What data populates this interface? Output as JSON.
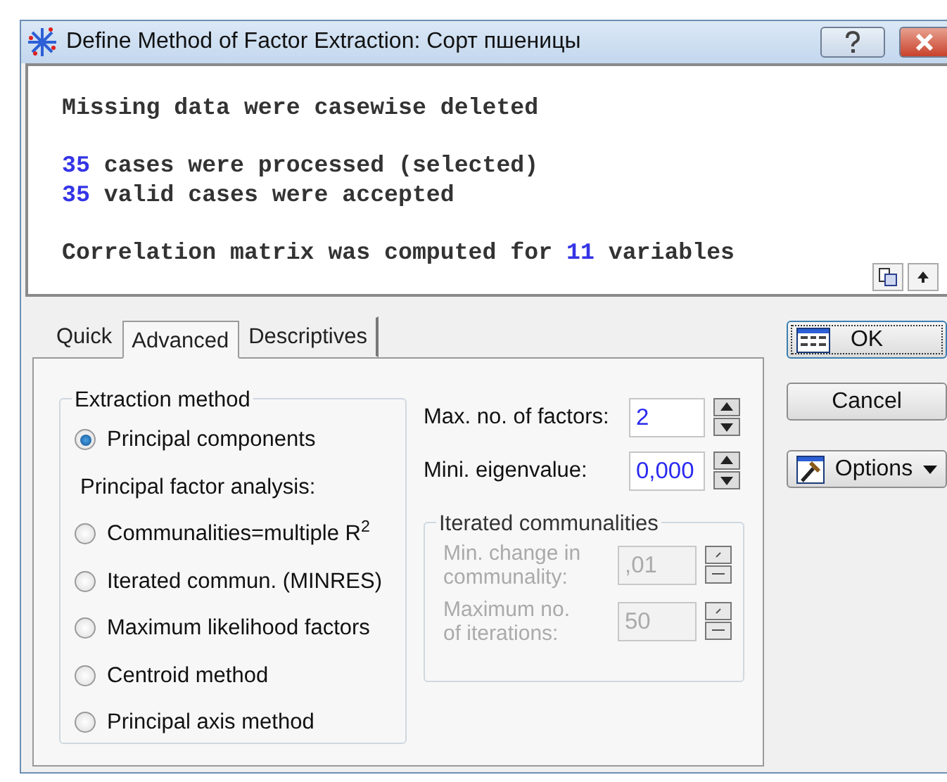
{
  "window": {
    "title": "Define Method of Factor Extraction: Сорт пшеницы"
  },
  "output": {
    "lines": [
      {
        "gap_before": false,
        "parts": [
          {
            "text": "Missing data were casewise deleted",
            "highlight": false
          }
        ]
      },
      {
        "gap_before": true,
        "parts": [
          {
            "text": "35",
            "highlight": true
          },
          {
            "text": " cases were processed (selected)",
            "highlight": false
          }
        ]
      },
      {
        "gap_before": false,
        "parts": [
          {
            "text": "35",
            "highlight": true
          },
          {
            "text": " valid cases were accepted",
            "highlight": false
          }
        ]
      },
      {
        "gap_before": true,
        "parts": [
          {
            "text": "Correlation matrix was computed for ",
            "highlight": false
          },
          {
            "text": "11",
            "highlight": true
          },
          {
            "text": " variables",
            "highlight": false
          }
        ]
      }
    ]
  },
  "tabs": [
    {
      "label": "Quick",
      "selected": false
    },
    {
      "label": "Advanced",
      "selected": true
    },
    {
      "label": "Descriptives",
      "selected": false
    }
  ],
  "extraction": {
    "title": "Extraction method",
    "items": [
      {
        "kind": "radio",
        "label": "Principal components",
        "selected": true
      },
      {
        "kind": "heading",
        "label": "Principal factor analysis:"
      },
      {
        "kind": "radio",
        "label": "Communalities=multiple R$^{2}$",
        "selected": false
      },
      {
        "kind": "radio",
        "label": "Iterated commun. (MINRES)",
        "selected": false
      },
      {
        "kind": "radio",
        "label": "Maximum likelihood factors",
        "selected": false
      },
      {
        "kind": "radio",
        "label": "Centroid method",
        "selected": false
      },
      {
        "kind": "radio",
        "label": "Principal axis method",
        "selected": false
      }
    ]
  },
  "params": [
    {
      "label": "Max. no. of factors:",
      "value": "2"
    },
    {
      "label": "Mini. eigenvalue:",
      "value": "0,000"
    }
  ],
  "iterated": {
    "title": "Iterated communalities",
    "disabled": true,
    "fields": [
      {
        "label": "Min. change in\ncommunality:",
        "value": ",01"
      },
      {
        "label": "Maximum no.\nof iterations:",
        "value": "50"
      }
    ]
  },
  "buttons": [
    {
      "kind": "ok",
      "label": "OK",
      "default": true
    },
    {
      "kind": "cancel",
      "label": "Cancel",
      "default": false
    },
    {
      "kind": "options",
      "label": "Options",
      "default": false,
      "dropdown": true
    }
  ]
}
